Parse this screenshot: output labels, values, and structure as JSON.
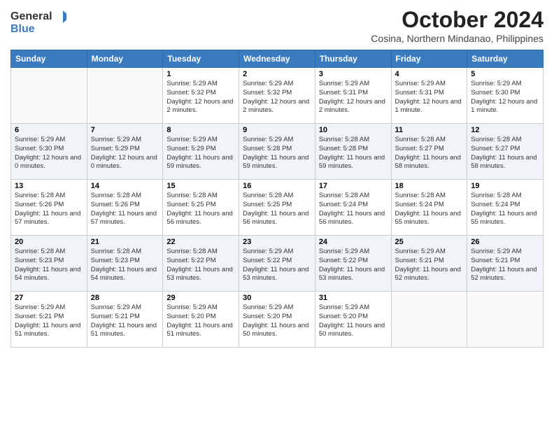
{
  "logo": {
    "general": "General",
    "blue": "Blue"
  },
  "title": "October 2024",
  "subtitle": "Cosina, Northern Mindanao, Philippines",
  "days_header": [
    "Sunday",
    "Monday",
    "Tuesday",
    "Wednesday",
    "Thursday",
    "Friday",
    "Saturday"
  ],
  "weeks": [
    [
      {
        "day": "",
        "info": ""
      },
      {
        "day": "",
        "info": ""
      },
      {
        "day": "1",
        "info": "Sunrise: 5:29 AM\nSunset: 5:32 PM\nDaylight: 12 hours and 2 minutes."
      },
      {
        "day": "2",
        "info": "Sunrise: 5:29 AM\nSunset: 5:32 PM\nDaylight: 12 hours and 2 minutes."
      },
      {
        "day": "3",
        "info": "Sunrise: 5:29 AM\nSunset: 5:31 PM\nDaylight: 12 hours and 2 minutes."
      },
      {
        "day": "4",
        "info": "Sunrise: 5:29 AM\nSunset: 5:31 PM\nDaylight: 12 hours and 1 minute."
      },
      {
        "day": "5",
        "info": "Sunrise: 5:29 AM\nSunset: 5:30 PM\nDaylight: 12 hours and 1 minute."
      }
    ],
    [
      {
        "day": "6",
        "info": "Sunrise: 5:29 AM\nSunset: 5:30 PM\nDaylight: 12 hours and 0 minutes."
      },
      {
        "day": "7",
        "info": "Sunrise: 5:29 AM\nSunset: 5:29 PM\nDaylight: 12 hours and 0 minutes."
      },
      {
        "day": "8",
        "info": "Sunrise: 5:29 AM\nSunset: 5:29 PM\nDaylight: 11 hours and 59 minutes."
      },
      {
        "day": "9",
        "info": "Sunrise: 5:29 AM\nSunset: 5:28 PM\nDaylight: 11 hours and 59 minutes."
      },
      {
        "day": "10",
        "info": "Sunrise: 5:28 AM\nSunset: 5:28 PM\nDaylight: 11 hours and 59 minutes."
      },
      {
        "day": "11",
        "info": "Sunrise: 5:28 AM\nSunset: 5:27 PM\nDaylight: 11 hours and 58 minutes."
      },
      {
        "day": "12",
        "info": "Sunrise: 5:28 AM\nSunset: 5:27 PM\nDaylight: 11 hours and 58 minutes."
      }
    ],
    [
      {
        "day": "13",
        "info": "Sunrise: 5:28 AM\nSunset: 5:26 PM\nDaylight: 11 hours and 57 minutes."
      },
      {
        "day": "14",
        "info": "Sunrise: 5:28 AM\nSunset: 5:26 PM\nDaylight: 11 hours and 57 minutes."
      },
      {
        "day": "15",
        "info": "Sunrise: 5:28 AM\nSunset: 5:25 PM\nDaylight: 11 hours and 56 minutes."
      },
      {
        "day": "16",
        "info": "Sunrise: 5:28 AM\nSunset: 5:25 PM\nDaylight: 11 hours and 56 minutes."
      },
      {
        "day": "17",
        "info": "Sunrise: 5:28 AM\nSunset: 5:24 PM\nDaylight: 11 hours and 56 minutes."
      },
      {
        "day": "18",
        "info": "Sunrise: 5:28 AM\nSunset: 5:24 PM\nDaylight: 11 hours and 55 minutes."
      },
      {
        "day": "19",
        "info": "Sunrise: 5:28 AM\nSunset: 5:24 PM\nDaylight: 11 hours and 55 minutes."
      }
    ],
    [
      {
        "day": "20",
        "info": "Sunrise: 5:28 AM\nSunset: 5:23 PM\nDaylight: 11 hours and 54 minutes."
      },
      {
        "day": "21",
        "info": "Sunrise: 5:28 AM\nSunset: 5:23 PM\nDaylight: 11 hours and 54 minutes."
      },
      {
        "day": "22",
        "info": "Sunrise: 5:28 AM\nSunset: 5:22 PM\nDaylight: 11 hours and 53 minutes."
      },
      {
        "day": "23",
        "info": "Sunrise: 5:29 AM\nSunset: 5:22 PM\nDaylight: 11 hours and 53 minutes."
      },
      {
        "day": "24",
        "info": "Sunrise: 5:29 AM\nSunset: 5:22 PM\nDaylight: 11 hours and 53 minutes."
      },
      {
        "day": "25",
        "info": "Sunrise: 5:29 AM\nSunset: 5:21 PM\nDaylight: 11 hours and 52 minutes."
      },
      {
        "day": "26",
        "info": "Sunrise: 5:29 AM\nSunset: 5:21 PM\nDaylight: 11 hours and 52 minutes."
      }
    ],
    [
      {
        "day": "27",
        "info": "Sunrise: 5:29 AM\nSunset: 5:21 PM\nDaylight: 11 hours and 51 minutes."
      },
      {
        "day": "28",
        "info": "Sunrise: 5:29 AM\nSunset: 5:21 PM\nDaylight: 11 hours and 51 minutes."
      },
      {
        "day": "29",
        "info": "Sunrise: 5:29 AM\nSunset: 5:20 PM\nDaylight: 11 hours and 51 minutes."
      },
      {
        "day": "30",
        "info": "Sunrise: 5:29 AM\nSunset: 5:20 PM\nDaylight: 11 hours and 50 minutes."
      },
      {
        "day": "31",
        "info": "Sunrise: 5:29 AM\nSunset: 5:20 PM\nDaylight: 11 hours and 50 minutes."
      },
      {
        "day": "",
        "info": ""
      },
      {
        "day": "",
        "info": ""
      }
    ]
  ]
}
